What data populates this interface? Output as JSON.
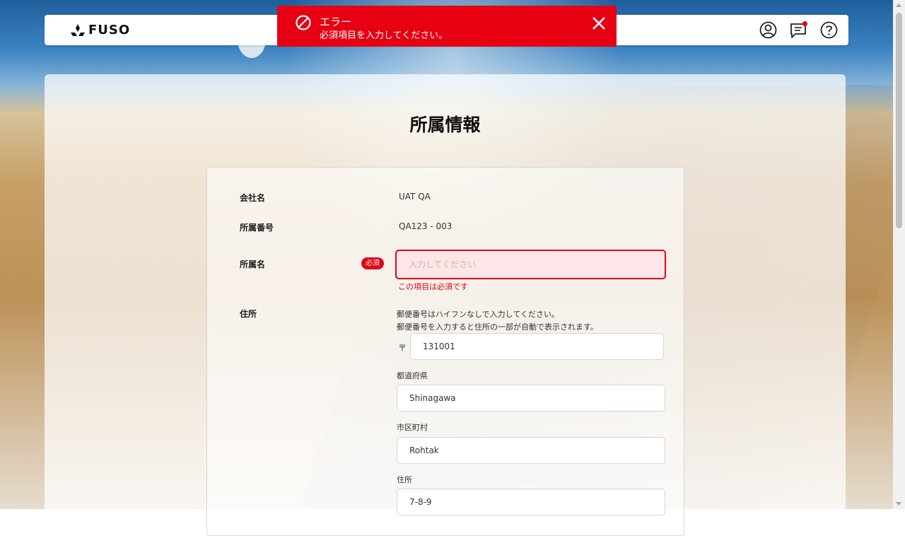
{
  "header": {
    "logo_text": "FUSO",
    "icons": [
      "account-icon",
      "chat-icon",
      "help-icon"
    ],
    "notification_dot_color": "#e60012"
  },
  "toast": {
    "title": "エラー",
    "message": "必須項目を入力してください。",
    "color": "#e60012"
  },
  "page": {
    "title": "所属情報"
  },
  "form": {
    "company": {
      "label": "会社名",
      "value": "UAT QA"
    },
    "affiliation_number": {
      "label": "所属番号",
      "value": "QA123 - 003"
    },
    "affiliation_name": {
      "label": "所属名",
      "required_badge": "必須",
      "placeholder": "入力してください",
      "value": "",
      "error": "この項目は必須です"
    },
    "address": {
      "label": "住所",
      "help_line1": "郵便番号はハイフンなしで入力してください。",
      "help_line2": "郵便番号を入力すると住所の一部が自動で表示されます。",
      "postal_mark": "〒",
      "postal_code": "131001",
      "prefecture_label": "都道府県",
      "prefecture": "Shinagawa",
      "city_label": "市区町村",
      "city": "Rohtak",
      "street_label": "住所",
      "street": "7-8-9"
    }
  }
}
